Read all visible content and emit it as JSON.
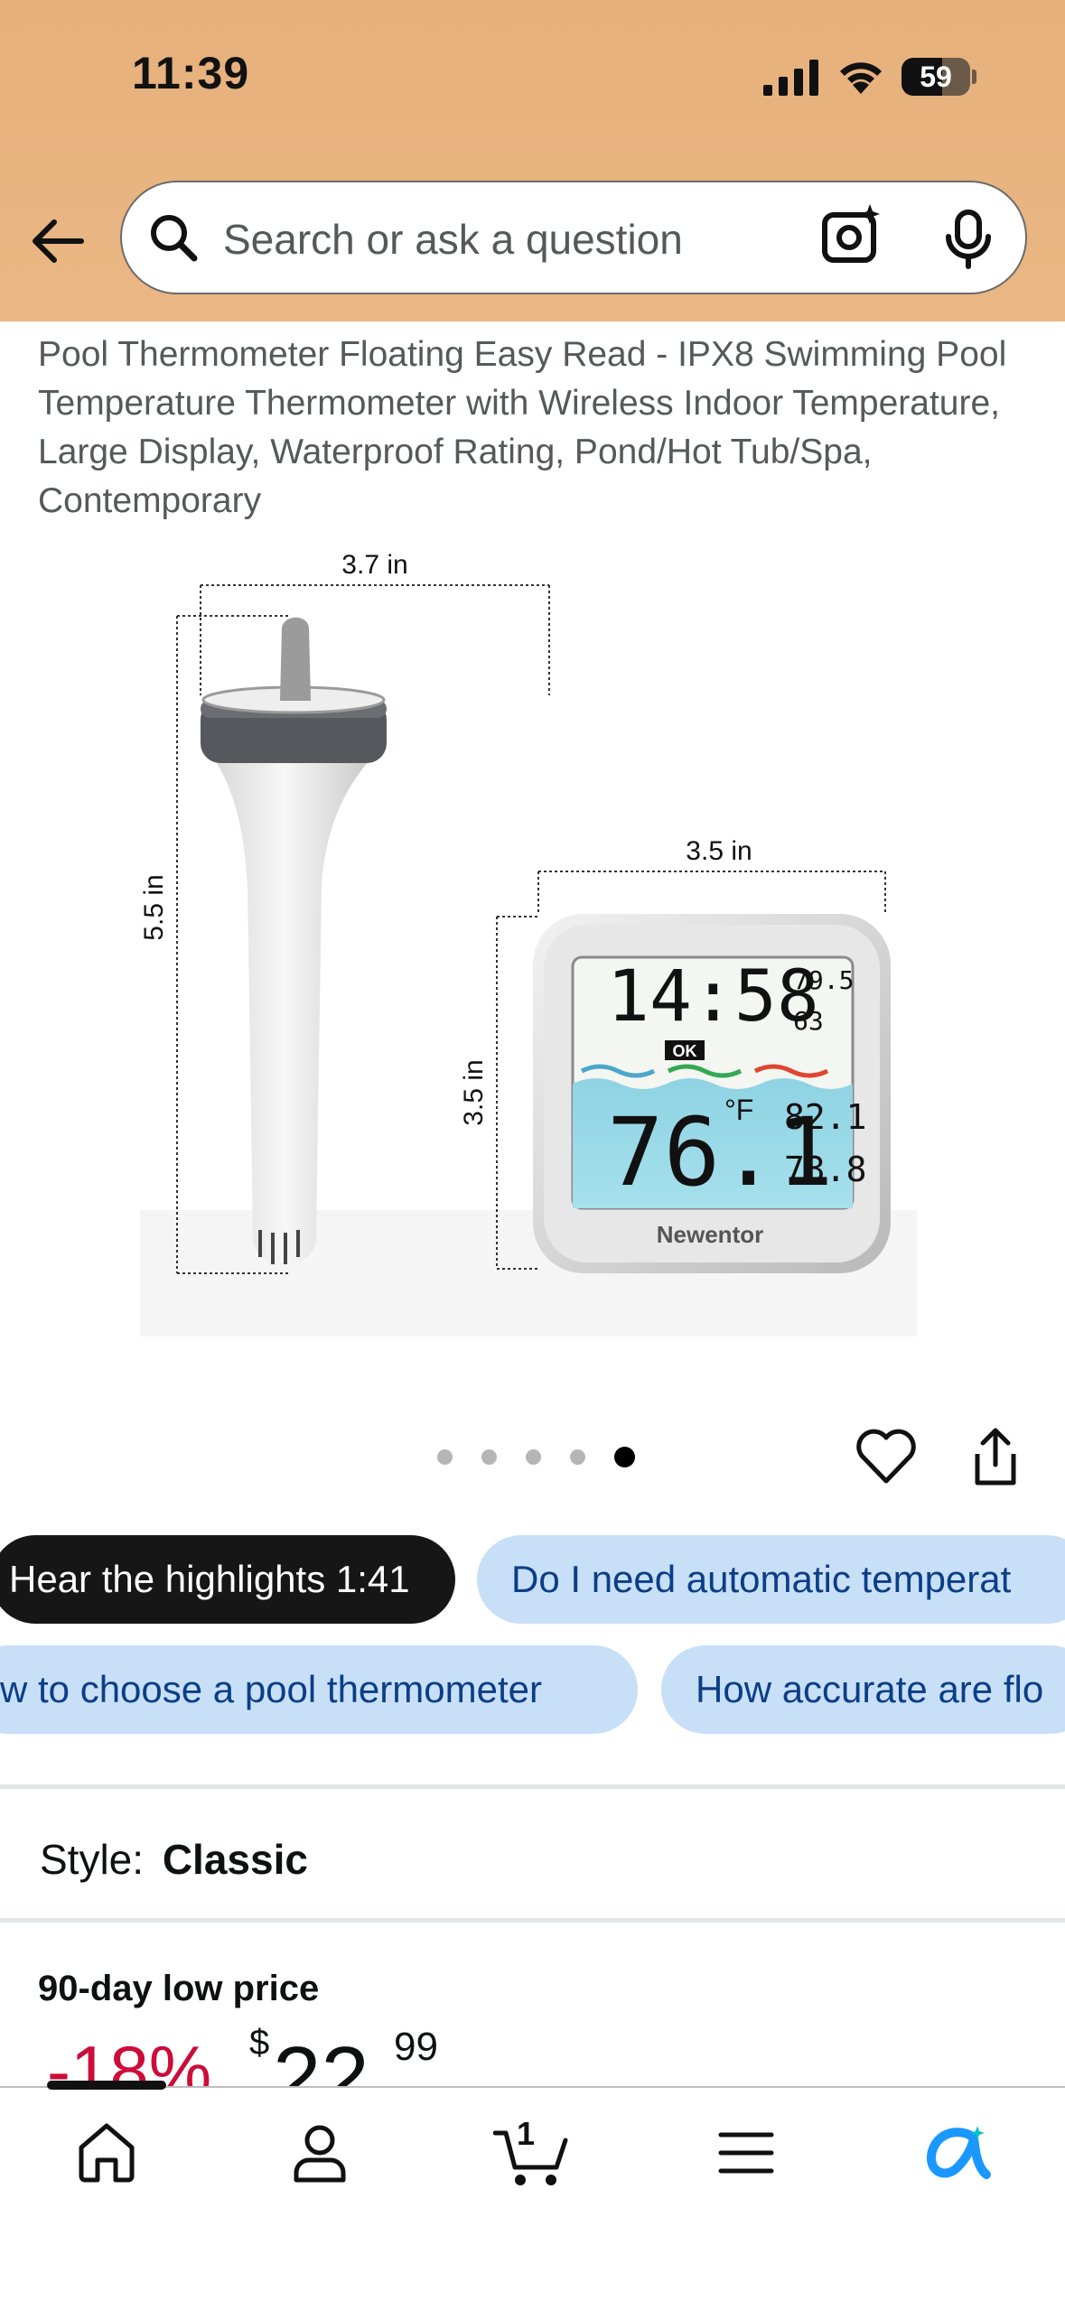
{
  "status_bar": {
    "time": "11:39",
    "battery": "59",
    "battery_level": 0.59
  },
  "search": {
    "placeholder": "Search or ask a question"
  },
  "product": {
    "title": "Pool Thermometer Floating Easy Read - IPX8 Swimming Pool Temperature Thermometer with Wireless Indoor Temperature, Large Display, Waterproof Rating, Pond/Hot Tub/Spa, Contemporary",
    "image": {
      "dim_width_float": "3.7 in",
      "dim_height_float": "5.5 in",
      "dim_width_display": "3.5 in",
      "dim_height_display": "3.5 in",
      "display_time": "14:58",
      "display_indoor_temp": "79.5",
      "display_humidity": "63",
      "display_ok": "OK",
      "display_pool_temp": "76.1",
      "display_unit": "°F",
      "display_max": "82.1",
      "display_min": "73.8",
      "brand": "Newentor"
    },
    "pager": {
      "count": 5,
      "active_index": 4
    }
  },
  "chips": [
    "Hear the highlights 1:41",
    "Do I need automatic temperat",
    "w to choose a pool thermometer",
    "How accurate are flo"
  ],
  "style": {
    "label": "Style:",
    "value": "Classic"
  },
  "deal": {
    "label": "90-day low price",
    "discount": "-18%",
    "currency": "$",
    "whole": "22",
    "fraction": "99"
  },
  "bottom_nav": {
    "cart_count": "1",
    "items": [
      "home",
      "account",
      "cart",
      "menu",
      "rufus"
    ]
  },
  "colors": {
    "header": "#e8b47f",
    "chip_dark": "#161616",
    "chip_light": "#c8dff8",
    "discount": "#cc0c39",
    "rufus": "#1a98ff"
  }
}
